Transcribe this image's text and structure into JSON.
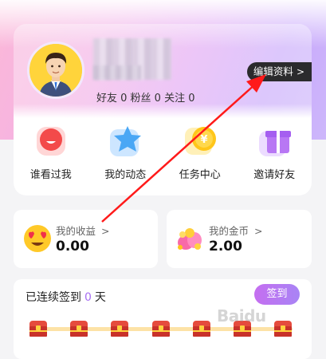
{
  "profile": {
    "stats": "好友 0 粉丝 0 关注 0",
    "edit_label": "编辑资料",
    "edit_chevron": ">"
  },
  "menu": [
    {
      "label": "谁看过我",
      "icon": "visitor-icon"
    },
    {
      "label": "我的动态",
      "icon": "star-icon"
    },
    {
      "label": "任务中心",
      "icon": "coin-task-icon"
    },
    {
      "label": "邀请好友",
      "icon": "gift-icon"
    }
  ],
  "earnings": {
    "title": "我的收益",
    "value": "0.00",
    "chevron": ">"
  },
  "coins": {
    "title": "我的金币",
    "value": "2.00",
    "chevron": ">"
  },
  "signin": {
    "prefix": "已连续签到",
    "days": "0",
    "suffix": "天",
    "button": "签到",
    "chests": 7
  },
  "watermark": "Baidu",
  "colors": {
    "accent": "#a76ef2",
    "annotation_arrow": "#ff1a1a"
  }
}
